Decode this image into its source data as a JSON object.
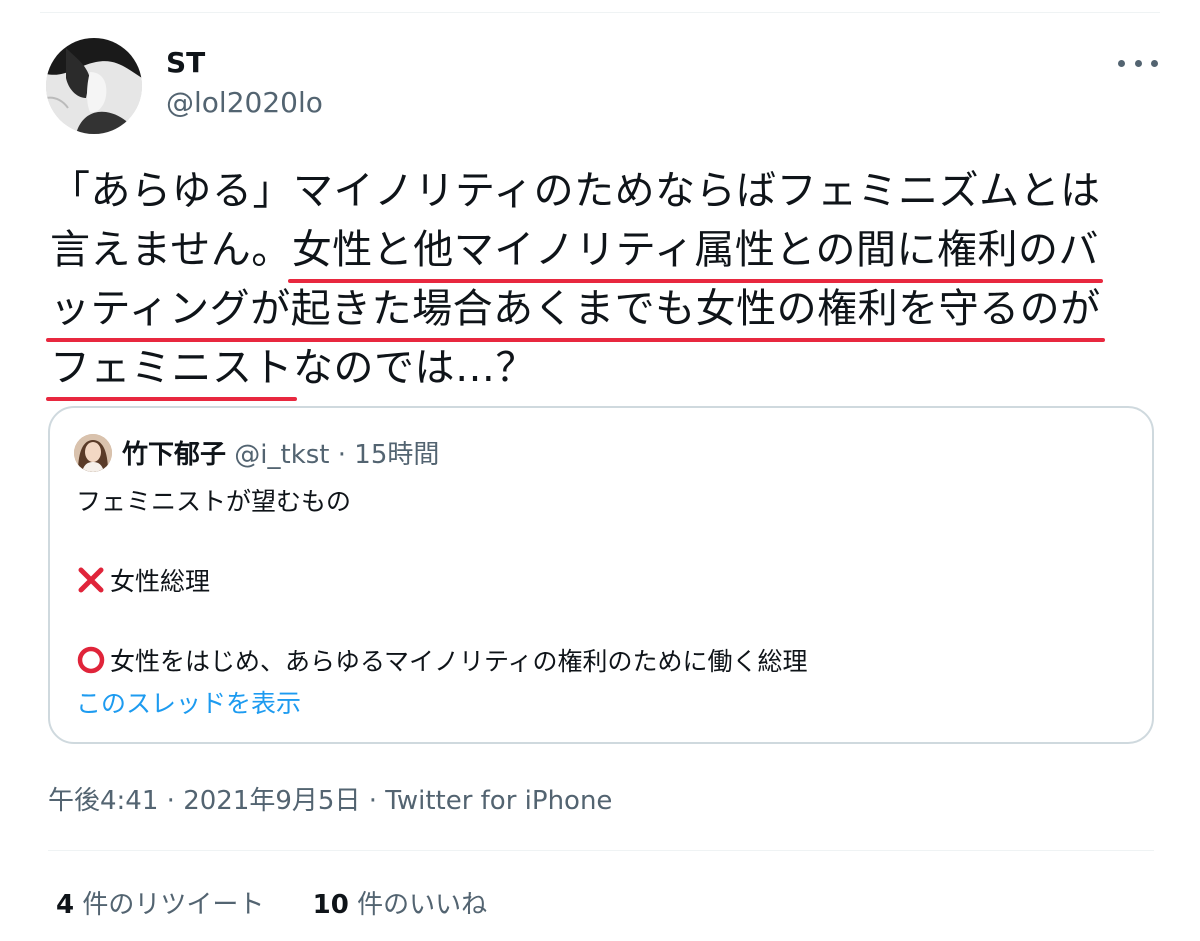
{
  "author": {
    "display_name": "ST",
    "handle": "@lol2020lo"
  },
  "tweet": {
    "lines": [
      [
        {
          "text": "「あらゆる」マイノリティのためならばフェミニズムとは",
          "highlight": false
        }
      ],
      [
        {
          "text": "言えません。",
          "highlight": false
        },
        {
          "text": "女性と他マイノリティ属性との間に権利のバ",
          "highlight": true
        }
      ],
      [
        {
          "text": "ッティングが起きた場合あくまでも女性の権利を守るのが",
          "highlight": true
        }
      ],
      [
        {
          "text": "フェミニスト",
          "highlight": true
        },
        {
          "text": "なのでは…？",
          "highlight": false
        }
      ]
    ]
  },
  "quoted": {
    "name": "竹下郁子",
    "handle": "@i_tkst",
    "separator": " · ",
    "time": "15時間",
    "line1": "フェミニストが望むもの",
    "line2": "女性総理",
    "line3": "女性をはじめ、あらゆるマイノリティの権利のために働く総理",
    "show_thread": "このスレッドを表示"
  },
  "meta": {
    "time": "午後4:41",
    "date": "2021年9月5日",
    "source": "Twitter for iPhone",
    "separator": " · "
  },
  "stats": {
    "retweets_count": "4",
    "retweets_label": " 件のリツイート",
    "likes_count": "10",
    "likes_label": " 件のいいね"
  },
  "colors": {
    "highlight_underline": "#e8283f",
    "link_blue": "#1d9bf0",
    "secondary_text": "#536471",
    "card_border": "#cfd9de"
  }
}
